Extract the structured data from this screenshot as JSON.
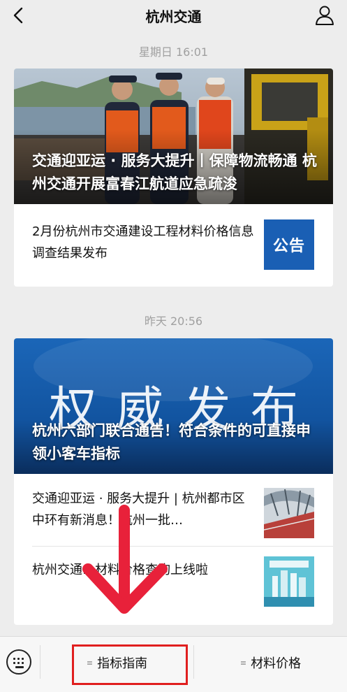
{
  "header": {
    "title": "杭州交通"
  },
  "feed": [
    {
      "timestamp": "星期日 16:01",
      "cover_title": "交通迎亚运 · 服务大提升丨保障物流畅通 杭州交通开展富春江航道应急疏浚",
      "items": [
        {
          "text": "2月份杭州市交通建设工程材料价格信息调查结果发布",
          "thumb_label": "公告",
          "thumb_color": "#1a5fb4"
        }
      ]
    },
    {
      "timestamp": "昨天 20:56",
      "cover_word": [
        "权",
        "威",
        "发",
        "布"
      ],
      "cover_title": "杭州六部门联合通告！符合条件的可直接申领小客车指标",
      "items": [
        {
          "text": "交通迎亚运 · 服务大提升 | 杭州都市区中环有新消息！杭州一批…"
        },
        {
          "text": "杭州交通…材料价格查询上线啦"
        }
      ]
    }
  ],
  "bottom_menu": {
    "items": [
      {
        "label": "指标指南",
        "icon": "menu-lines-icon"
      },
      {
        "label": "材料价格",
        "icon": "menu-lines-icon"
      }
    ],
    "highlight_color": "#e01f1f"
  },
  "annotation": {
    "arrow_color": "#e8213a"
  }
}
